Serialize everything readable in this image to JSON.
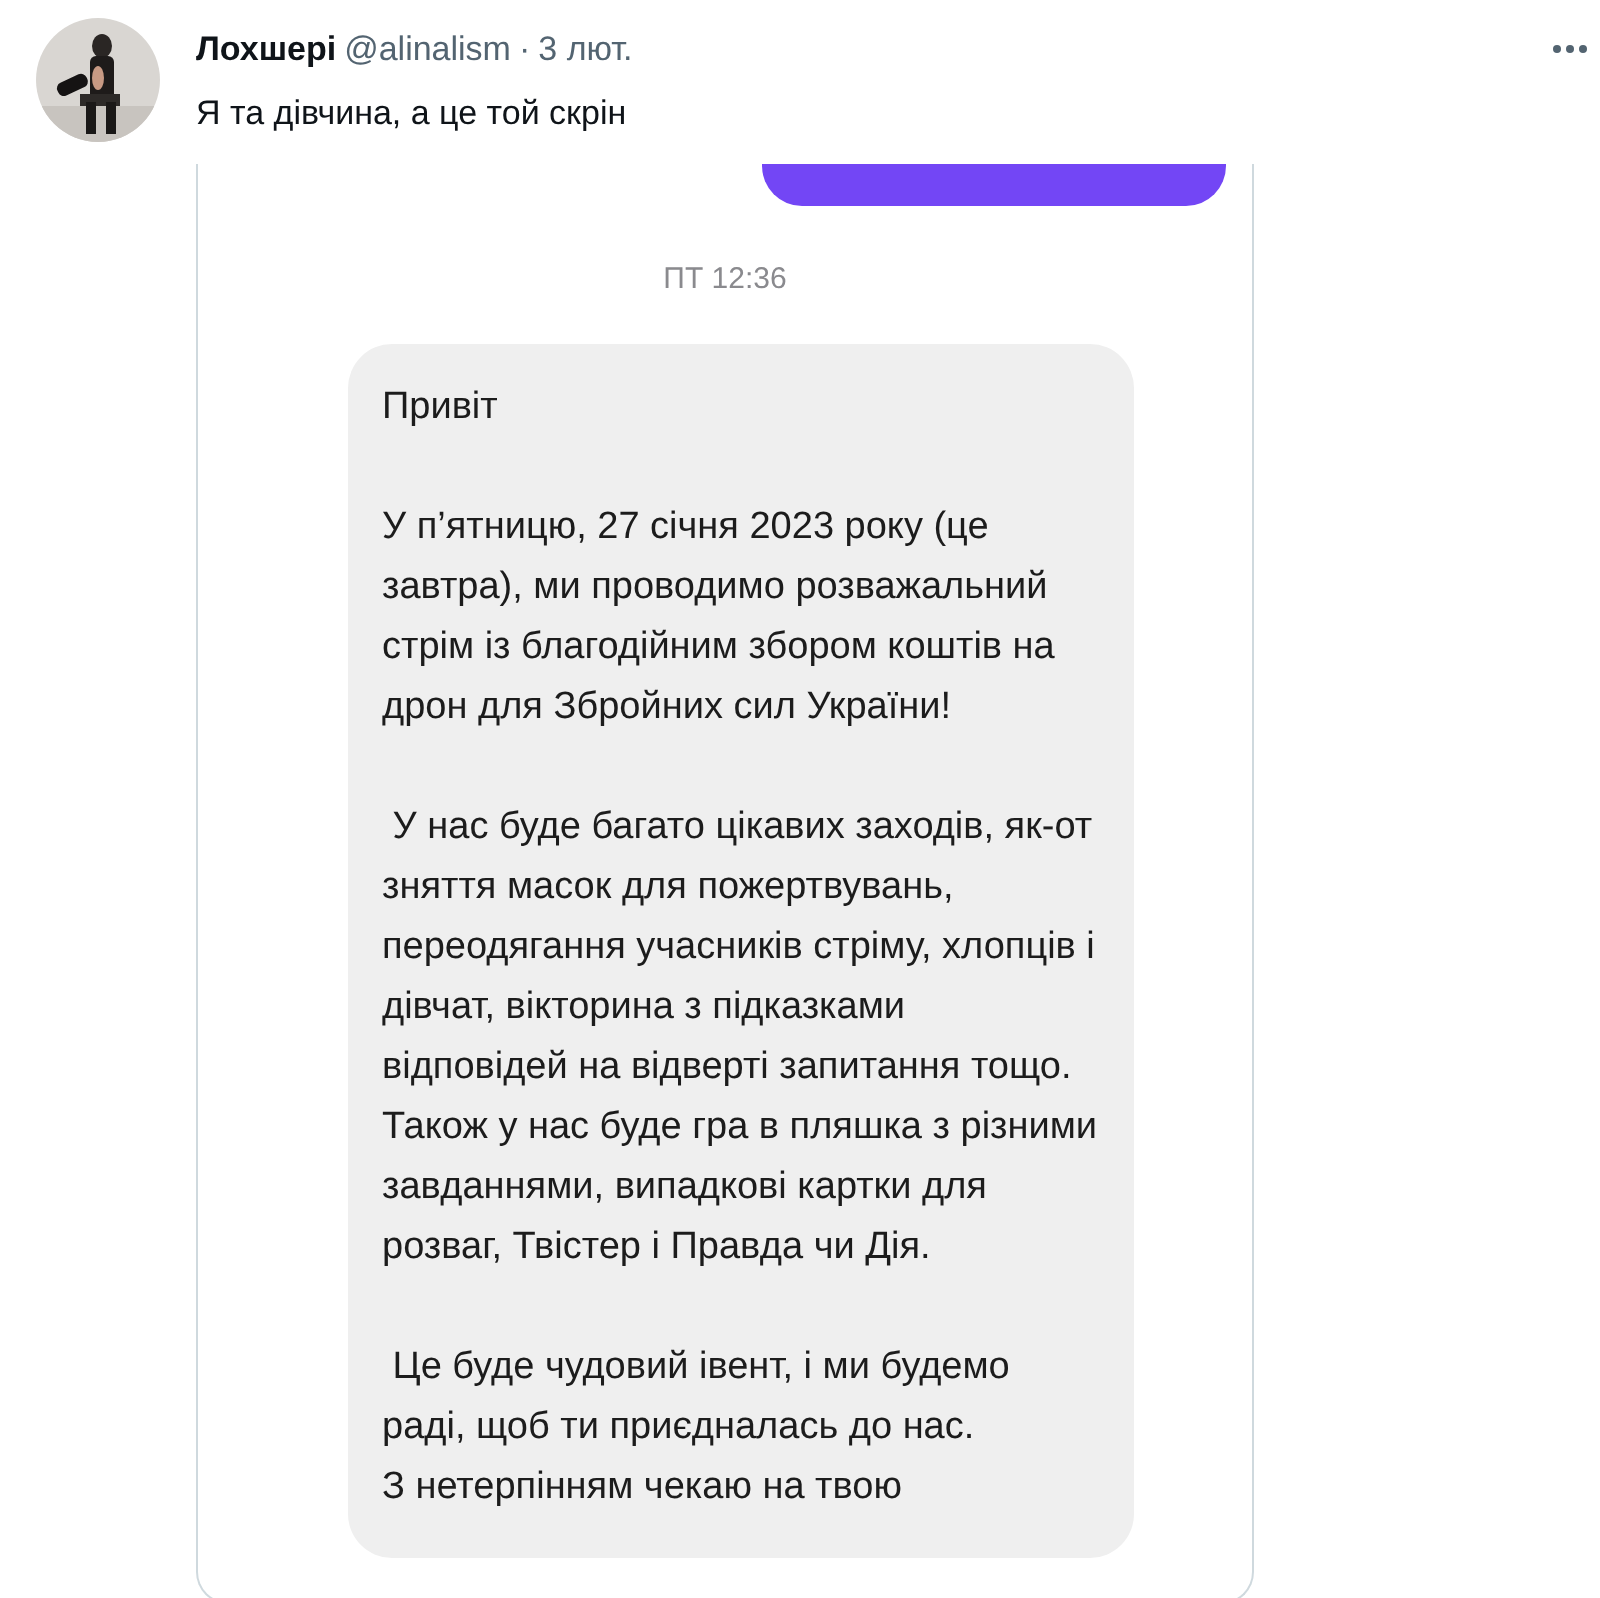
{
  "tweet": {
    "display_name": "Лохшері",
    "handle": "@alinalism",
    "separator": "·",
    "date": "3 лют.",
    "text": "Я та дівчина, а це той скрін",
    "screenshot": {
      "timestamp": "ПТ 12:36",
      "message_paragraphs": [
        "Привіт",
        "У п’ятницю, 27 січня 2023 року (це завтра), ми проводимо розважальний стрім із благодійним збором коштів на дрон для Збройних сил України!",
        " У нас буде багато цікавих заходів, як-от зняття масок для пожертвувань, переодягання учасників стріму, хлопців і дівчат, вікторина з підказками відповідей на відверті запитання тощо. Також у нас буде гра в пляшка з різними завданнями, випадкові картки для розваг, Твістер і Правда чи Дія.",
        " Це буде чудовий івент, і ми будемо раді, щоб ти приєдналась до нас.\nЗ нетерпінням чекаю на твою"
      ]
    }
  }
}
